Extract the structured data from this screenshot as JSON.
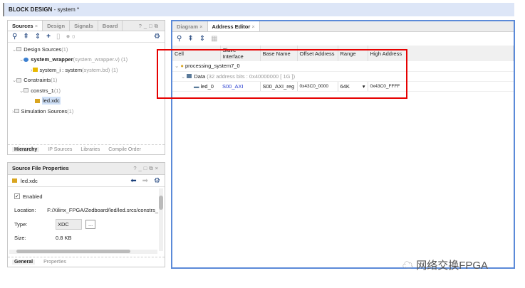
{
  "title": {
    "main": "BLOCK DESIGN",
    "sub": " - system *"
  },
  "sources": {
    "tabs": [
      "Sources",
      "Design",
      "Signals",
      "Board"
    ],
    "toolbar_count": "0",
    "tree": [
      {
        "label": "Design Sources",
        "suffix": " (1)"
      },
      {
        "label": "system_wrapper",
        "suffix": " (system_wrapper.v) (1)"
      },
      {
        "label": "system_i : system",
        "suffix": " (system.bd) (1)"
      },
      {
        "label": "Constraints",
        "suffix": " (1)"
      },
      {
        "label": "constrs_1",
        "suffix": " (1)"
      },
      {
        "label": "led.xdc",
        "suffix": ""
      },
      {
        "label": "Simulation Sources",
        "suffix": " (1)"
      }
    ],
    "bottom_tabs": [
      "Hierarchy",
      "IP Sources",
      "Libraries",
      "Compile Order"
    ]
  },
  "props": {
    "title": "Source File Properties",
    "file": "led.xdc",
    "enabled": "Enabled",
    "location_label": "Location:",
    "location": "F:/Xilinx_FPGA/Zedboard/led/led.srcs/constrs_",
    "type_label": "Type:",
    "type": "XDC",
    "browse": "...",
    "size_label": "Size:",
    "size": "0.8 KB",
    "tabs": [
      "General",
      "Properties"
    ]
  },
  "editor": {
    "tabs": [
      "Diagram",
      "Address Editor"
    ],
    "columns": [
      "Cell",
      "Slave Interface",
      "Base Name",
      "Offset Address",
      "Range",
      "High Address"
    ],
    "root": "processing_system7_0",
    "data": "Data",
    "data_info": " (32 address bits : 0x40000000 [ 1G ])",
    "row": {
      "cell": "led_0",
      "slave": "S00_AXI",
      "base": "S00_AXI_reg",
      "offset": "0x43C0_0000",
      "range": "64K",
      "high": "0x43C0_FFFF"
    }
  },
  "watermark": "网络交换FPGA",
  "colors": {
    "highlight": "#e60000",
    "accent": "#2a62c9"
  }
}
